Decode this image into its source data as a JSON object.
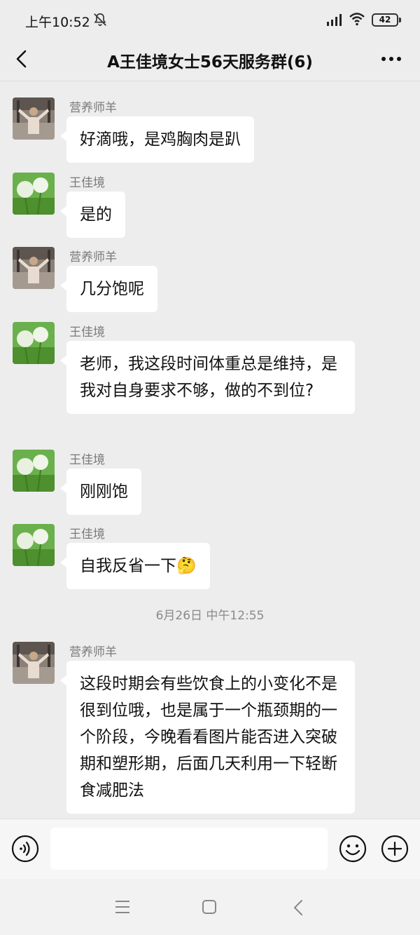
{
  "status": {
    "time": "上午10:52",
    "battery": "42"
  },
  "header": {
    "title": "A王佳境女士56天服务群(6)"
  },
  "messages": [
    {
      "sender": "营养师羊",
      "text": "好滴哦，是鸡胸肉是趴",
      "avatar": "nutritionist-avatar"
    },
    {
      "sender": "王佳境",
      "text": "是的",
      "avatar": "dandelion-avatar"
    },
    {
      "sender": "营养师羊",
      "text": "几分饱呢",
      "avatar": "nutritionist-avatar"
    },
    {
      "sender": "王佳境",
      "text": "老师，我这段时间体重总是维持，是我对自身要求不够，做的不到位?",
      "avatar": "dandelion-avatar"
    },
    {
      "sender": "王佳境",
      "text": "刚刚饱",
      "avatar": "dandelion-avatar"
    },
    {
      "sender": "王佳境",
      "text": "自我反省一下",
      "emoji": "🤔",
      "avatar": "dandelion-avatar"
    },
    {
      "sender": "营养师羊",
      "text": "这段时期会有些饮食上的小变化不是很到位哦，也是属于一个瓶颈期的一个阶段，今晚看看图片能否进入突破期和塑形期，后面几天利用一下轻断食减肥法",
      "avatar": "nutritionist-avatar"
    }
  ],
  "timestamp": "6月26日 中午12:55",
  "input": {
    "value": ""
  },
  "icons": [
    "back-icon",
    "more-icon",
    "voice-icon",
    "emoji-icon",
    "plus-icon",
    "bell-muted-icon",
    "signal-icon",
    "wifi-icon"
  ]
}
